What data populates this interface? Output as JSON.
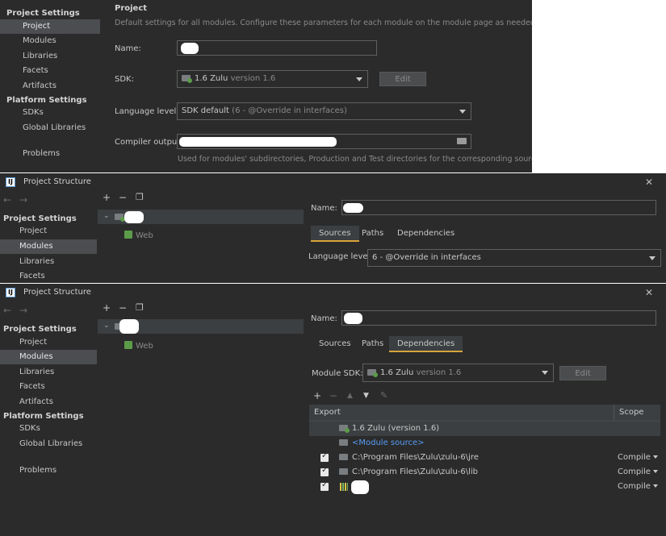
{
  "panel1": {
    "sidebar": {
      "project_settings": "Project Settings",
      "items": [
        "Project",
        "Modules",
        "Libraries",
        "Facets",
        "Artifacts"
      ],
      "platform_settings": "Platform Settings",
      "platform_items": [
        "SDKs",
        "Global Libraries"
      ],
      "problems": "Problems"
    },
    "heading": "Project",
    "description": "Default settings for all modules. Configure these parameters for each module on the module page as needed.",
    "name_label": "Name:",
    "sdk_label": "SDK:",
    "sdk_value": "1.6 Zulu",
    "sdk_version": "version 1.6",
    "edit_button": "Edit",
    "language_label": "Language level:",
    "language_value": "SDK default",
    "language_hint": "(6 - @Override in interfaces)",
    "compiler_label": "Compiler output:",
    "compiler_note": "Used for modules' subdirectories, Production and Test directories for the corresponding sources."
  },
  "panel2": {
    "title": "Project Structure",
    "close": "✕",
    "nav": {
      "back": "←",
      "forward": "→"
    },
    "sidebar": {
      "project_settings": "Project Settings",
      "items": [
        "Project",
        "Modules",
        "Libraries",
        "Facets"
      ]
    },
    "tools": {
      "add": "+",
      "remove": "−",
      "copy": "❐"
    },
    "tree_child": "Web",
    "name_label": "Name:",
    "tabs": [
      "Sources",
      "Paths",
      "Dependencies"
    ],
    "language_label": "Language level:",
    "language_value": "6 - @Override in interfaces"
  },
  "panel3": {
    "title": "Project Structure",
    "close": "✕",
    "nav": {
      "back": "←",
      "forward": "→"
    },
    "sidebar": {
      "project_settings": "Project Settings",
      "items": [
        "Project",
        "Modules",
        "Libraries",
        "Facets",
        "Artifacts"
      ],
      "platform_settings": "Platform Settings",
      "platform_items": [
        "SDKs",
        "Global Libraries"
      ],
      "problems": "Problems"
    },
    "tools": {
      "add": "+",
      "remove": "−",
      "copy": "❐"
    },
    "tree_child": "Web",
    "name_label": "Name:",
    "tabs": [
      "Sources",
      "Paths",
      "Dependencies"
    ],
    "module_sdk_label": "Module SDK:",
    "module_sdk_value": "1.6 Zulu",
    "module_sdk_version": "version 1.6",
    "edit_button": "Edit",
    "dep_tools": {
      "add": "+",
      "remove": "−",
      "up": "▲",
      "down": "▼",
      "edit": "✎"
    },
    "table": {
      "col_export": "Export",
      "col_scope": "Scope",
      "rows": [
        {
          "label": "1.6 Zulu (version 1.6)",
          "scope": ""
        },
        {
          "label": "<Module source>",
          "scope": ""
        },
        {
          "label": "C:\\Program Files\\Zulu\\zulu-6\\jre",
          "scope": "Compile"
        },
        {
          "label": "C:\\Program Files\\Zulu\\zulu-6\\lib",
          "scope": "Compile"
        },
        {
          "label": "",
          "scope": "Compile"
        }
      ]
    }
  }
}
